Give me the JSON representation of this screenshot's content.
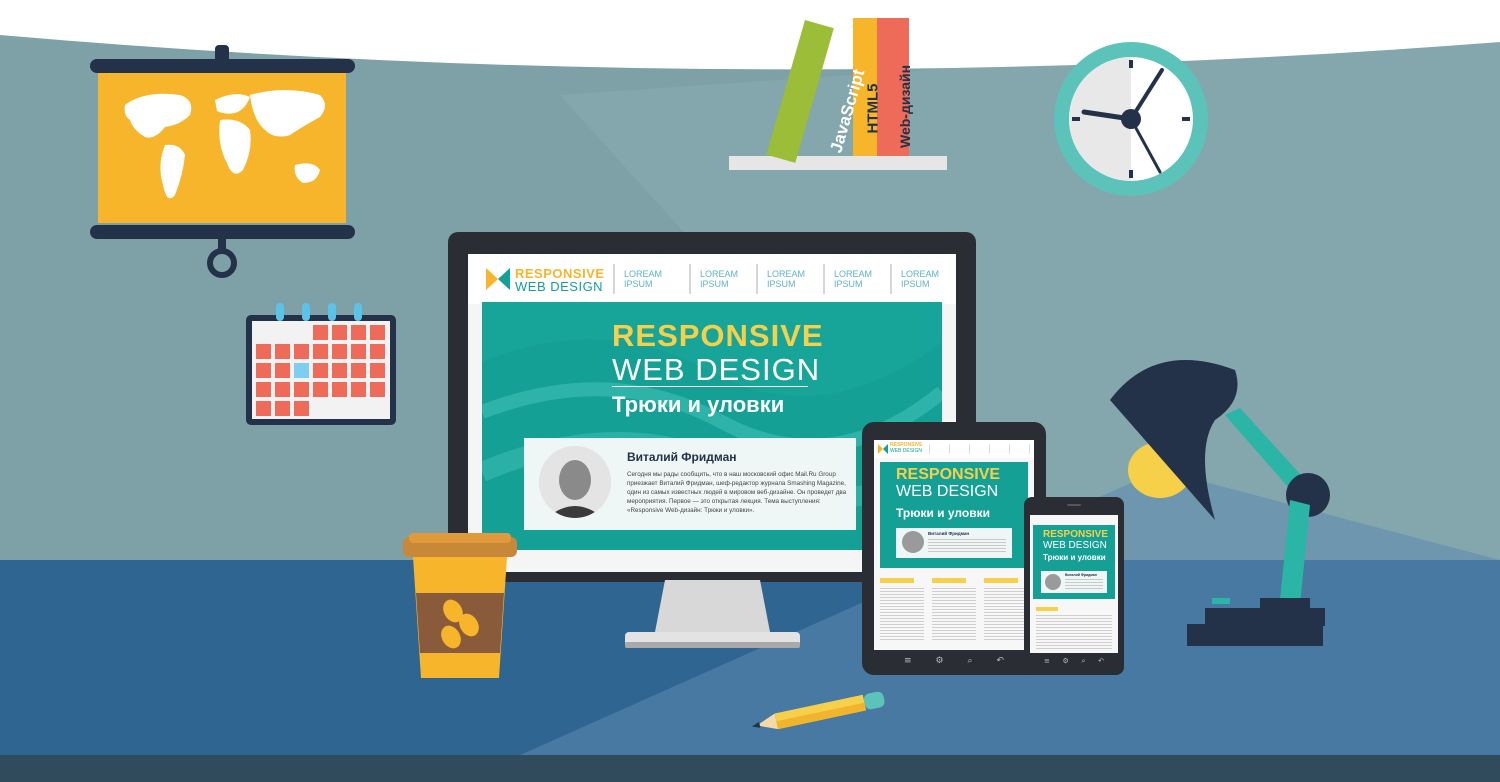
{
  "colors": {
    "wall": "#7fa3a9",
    "sky": "#ffffff",
    "desk": "#2e6591",
    "floor": "#2f4b5c",
    "teal": "#15a095",
    "yellow": "#f7b52c",
    "salmon": "#ee6b5a",
    "navy": "#233248",
    "green": "#9cbd38"
  },
  "books": [
    "JavaScript",
    "HTML5",
    "Web-дизайн"
  ],
  "site": {
    "logo_line1": "RESPONSIVE",
    "logo_line2": "WEB DESIGN",
    "nav": [
      {
        "line1": "LOREAM",
        "line2": "IPSUM"
      },
      {
        "line1": "LOREAM",
        "line2": "IPSUM"
      },
      {
        "line1": "LOREAM",
        "line2": "IPSUM"
      },
      {
        "line1": "LOREAM",
        "line2": "IPSUM"
      },
      {
        "line1": "LOREAM",
        "line2": "IPSUM"
      }
    ],
    "hero_line1": "RESPONSIVE",
    "hero_line2": "WEB DESIGN",
    "hero_subtitle": "Трюки и уловки",
    "speaker_name": "Виталий Фридман",
    "speaker_bio": "Сегодня мы рады сообщить, что в наш московский офис Mail.Ru Group приезжает Виталий Фридман, шеф-редактор журнала Smashing Magazine, один из самых известных людей в мировом веб-дизайне. Он проведет два мероприятия. Первое — это открытая лекция. Тема выступления: «Responsive Web-дизайн: Трюки и уловки»."
  },
  "tablet": {
    "logo_line1": "RESPONSIVE",
    "logo_line2": "WEB DESIGN",
    "hero_line1": "RESPONSIVE",
    "hero_line2": "WEB DESIGN",
    "hero_subtitle": "Трюки и уловки",
    "speaker_name": "Виталий Фридман"
  },
  "phone": {
    "hero_line1": "RESPONSIVE",
    "hero_line2": "WEB DESIGN",
    "hero_subtitle": "Трюки и уловки",
    "speaker_name": "Виталий Фридман"
  }
}
